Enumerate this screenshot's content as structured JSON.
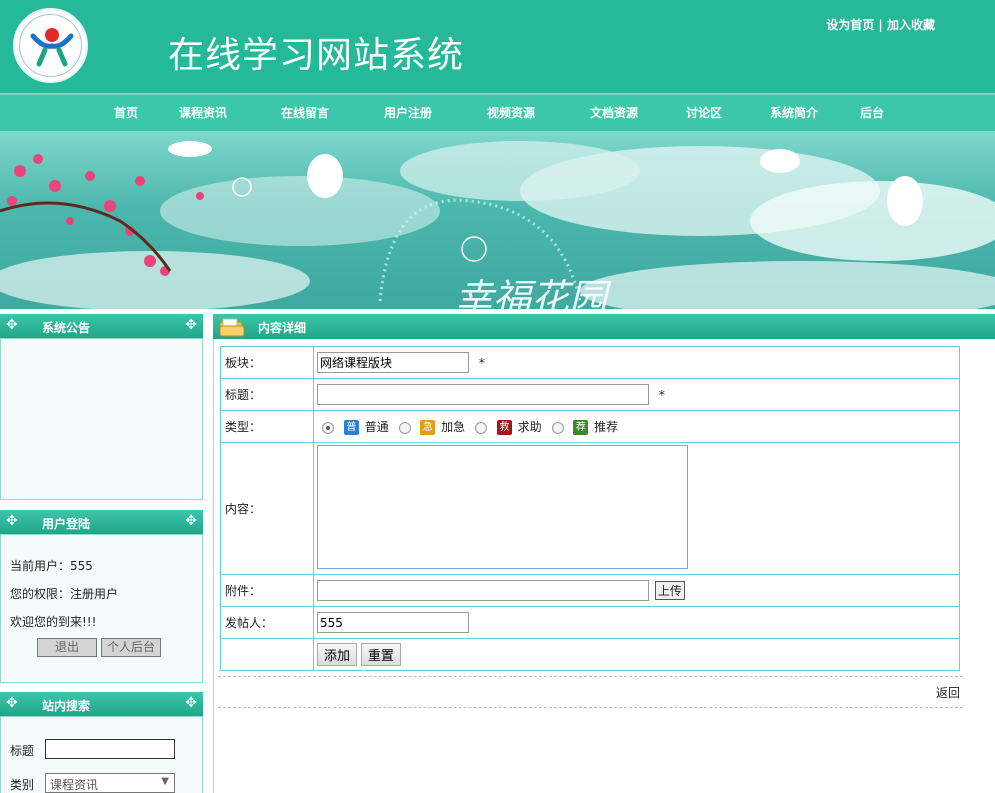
{
  "header": {
    "site_title": "在线学习网站系统",
    "set_homepage": "设为首页",
    "separator": "|",
    "add_favorite": "加入收藏"
  },
  "nav": {
    "items": [
      "首页",
      "课程资讯",
      "在线留言",
      "用户注册",
      "视频资源",
      "文档资源",
      "讨论区",
      "系统简介",
      "后台"
    ]
  },
  "banner": {
    "text": "幸福花园"
  },
  "sidebar": {
    "notice_title": "系统公告",
    "login_title": "用户登陆",
    "current_user": "当前用户：555",
    "permission": "您的权限：注册用户",
    "welcome": "欢迎您的到来!!!",
    "logout_label": "退出",
    "personal_backend_label": "个人后台",
    "search_title": "站内搜索",
    "search_title_label": "标题",
    "search_category_label": "类别",
    "search_category_value": "课程资讯"
  },
  "content": {
    "header_title": "内容详细",
    "board_label": "板块：",
    "board_value": "网络课程版块",
    "title_label": "标题：",
    "title_value": "",
    "required_mark": "*",
    "type_label": "类型：",
    "types": [
      {
        "tag": "普",
        "label": "普通",
        "color": "#2b7fd4",
        "checked": true
      },
      {
        "tag": "急",
        "label": "加急",
        "color": "#e89a1a",
        "checked": false
      },
      {
        "tag": "救",
        "label": "求助",
        "color": "#a01818",
        "checked": false
      },
      {
        "tag": "荐",
        "label": "推荐",
        "color": "#3a8a2a",
        "checked": false
      }
    ],
    "content_label": "内容：",
    "attachment_label": "附件：",
    "upload_label": "上传",
    "poster_label": "发帖人：",
    "poster_value": "555",
    "add_label": "添加",
    "reset_label": "重置",
    "back_label": "返回"
  }
}
